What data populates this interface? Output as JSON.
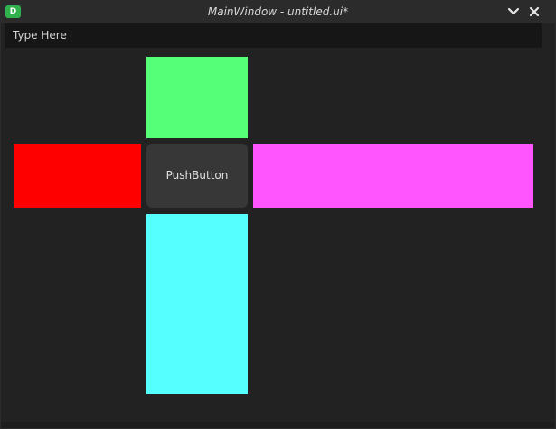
{
  "window": {
    "title": "MainWindow - untitled.ui*",
    "app_icon_letter": "D"
  },
  "icons": {
    "app": "designer-app-icon",
    "minimize": "chevron-down-icon",
    "close": "close-icon"
  },
  "menubar": {
    "placeholder_item": "Type Here"
  },
  "central": {
    "push_button_label": "PushButton",
    "colors": {
      "top": "#55ff77",
      "left": "#ff0000",
      "right": "#ff55ff",
      "bottom": "#55ffff"
    }
  }
}
